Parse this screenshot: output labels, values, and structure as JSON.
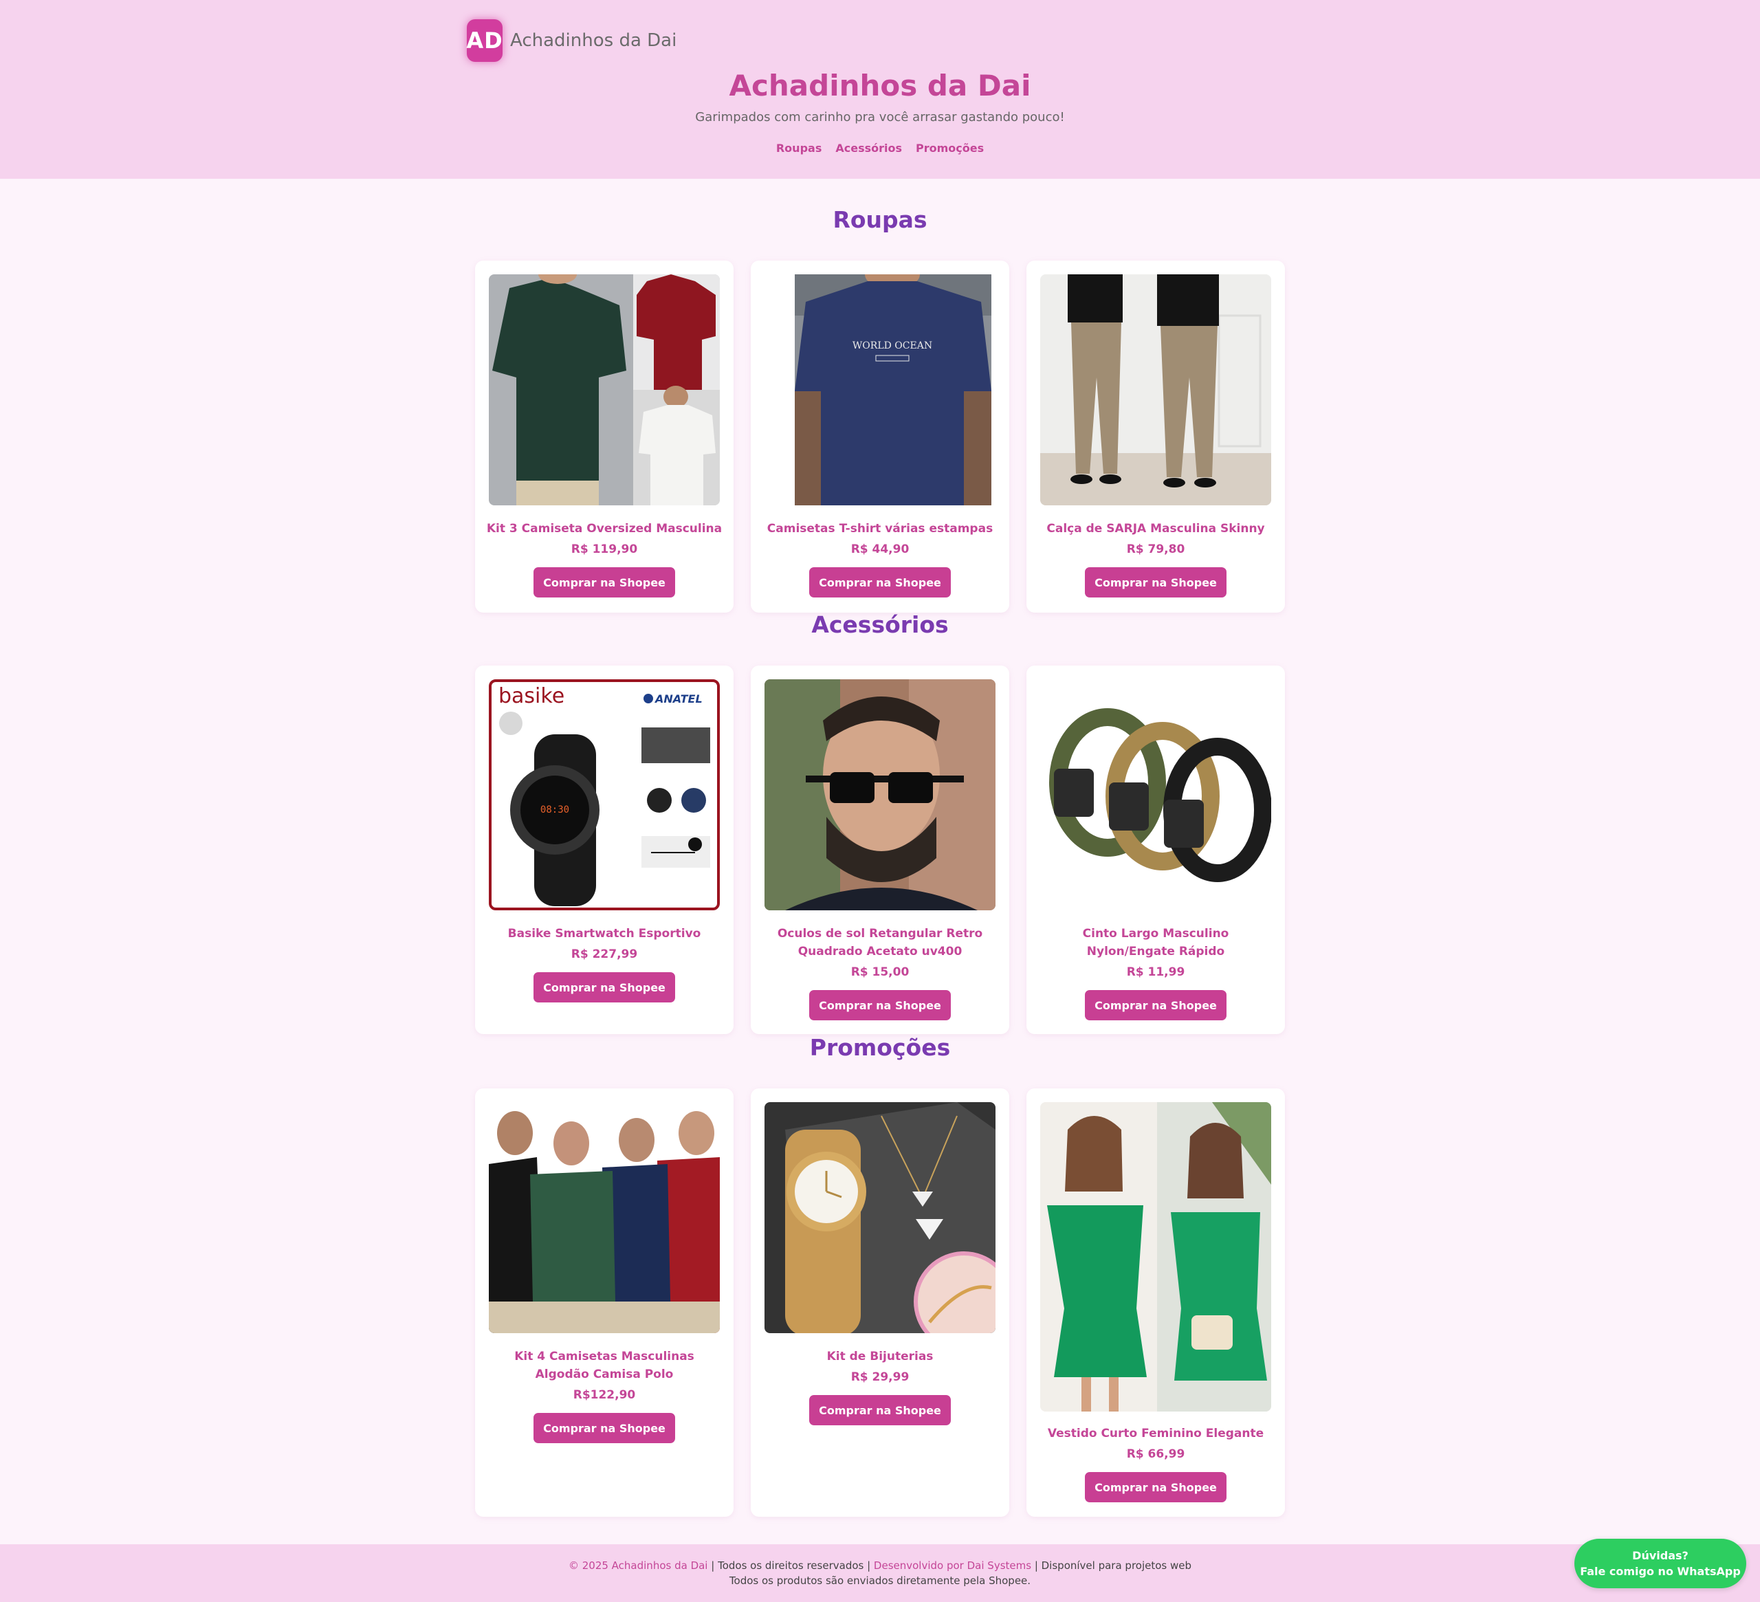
{
  "header": {
    "logo_initials": "AD",
    "brand_name": "Achadinhos da Dai",
    "title": "Achadinhos da Dai",
    "subtitle": "Garimpados com carinho pra você arrasar gastando pouco!",
    "nav": [
      "Roupas",
      "Acessórios",
      "Promoções"
    ]
  },
  "sections": [
    {
      "title": "Roupas",
      "products": [
        {
          "name": "Kit 3 Camiseta Oversized Masculina",
          "price": "R$ 119,90",
          "button": "Comprar na Shopee",
          "image": "three-oversized-tshirts-photo"
        },
        {
          "name": "Camisetas T-shirt várias estampas",
          "price": "R$ 44,90",
          "button": "Comprar na Shopee",
          "image": "navy-world-ocean-tshirt-photo"
        },
        {
          "name": "Calça de SARJA Masculina Skinny",
          "price": "R$ 79,80",
          "button": "Comprar na Shopee",
          "image": "khaki-skinny-pants-photo"
        }
      ]
    },
    {
      "title": "Acessórios",
      "products": [
        {
          "name": "Basike Smartwatch Esportivo",
          "price": "R$ 227,99",
          "button": "Comprar na Shopee",
          "image": "smartwatch-product-photo",
          "image_text": {
            "brand": "basike",
            "cert": "ANATEL"
          }
        },
        {
          "name": "Oculos de sol Retangular Retro Quadrado Acetato uv400",
          "price": "R$ 15,00",
          "button": "Comprar na Shopee",
          "image": "sunglasses-model-photo"
        },
        {
          "name": "Cinto Largo Masculino Nylon/Engate Rápido",
          "price": "R$ 11,99",
          "button": "Comprar na Shopee",
          "image": "tactical-belts-photo"
        }
      ]
    },
    {
      "title": "Promoções",
      "products": [
        {
          "name": "Kit 4 Camisetas Masculinas Algodão Camisa Polo",
          "price": "R$122,90",
          "button": "Comprar na Shopee",
          "image": "four-polo-shirts-photo"
        },
        {
          "name": "Kit de Bijuterias",
          "price": "R$ 29,99",
          "button": "Comprar na Shopee",
          "image": "gold-watch-jewelry-kit-photo"
        },
        {
          "name": "Vestido Curto Feminino Elegante",
          "price": "R$ 66,99",
          "button": "Comprar na Shopee",
          "image": "green-dress-photo"
        }
      ]
    }
  ],
  "footer": {
    "copyright": "© 2025 Achadinhos da Dai",
    "rights": " | Todos os direitos reservados | ",
    "developer": "Desenvolvido por Dai Systems",
    "available": " | Disponível para projetos web",
    "shipping": "Todos os produtos são enviados diretamente pela Shopee."
  },
  "whatsapp": {
    "line1": "Dúvidas?",
    "line2": "Fale comigo no WhatsApp",
    "color": "#2dce60"
  },
  "colors": {
    "header_bg": "#f6d3ee",
    "accent": "#c44697",
    "section_title": "#7a3bb0",
    "button": "#c83f93",
    "page_bg": "#fdf3fb"
  }
}
